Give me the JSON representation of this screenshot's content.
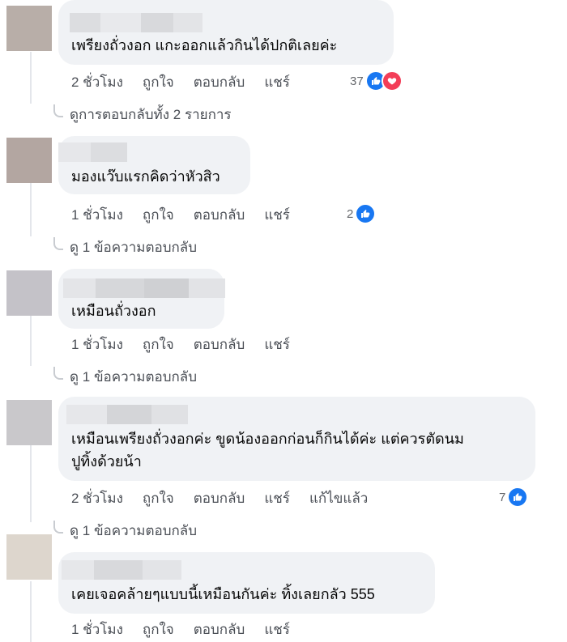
{
  "comments": [
    {
      "text_lines": [
        "เพรียงถั่วงอก แกะออกแล้วกินได้ปกติเลยค่ะ"
      ],
      "time": "2 ชั่วโมง",
      "like": "ถูกใจ",
      "reply": "ตอบกลับ",
      "share": "แชร์",
      "reaction_count": "37",
      "reaction_icons": [
        "like-icon",
        "love-icon"
      ],
      "view_replies": "ดูการตอบกลับทั้ง 2 รายการ"
    },
    {
      "text_lines": [
        "มองแว๊บแรกคิดว่าหัวสิว"
      ],
      "time": "1 ชั่วโมง",
      "like": "ถูกใจ",
      "reply": "ตอบกลับ",
      "share": "แชร์",
      "reaction_count": "2",
      "reaction_icons": [
        "like-icon"
      ],
      "view_replies": "ดู 1 ข้อความตอบกลับ"
    },
    {
      "text_lines": [
        "เหมือนถั่วงอก"
      ],
      "time": "1 ชั่วโมง",
      "like": "ถูกใจ",
      "reply": "ตอบกลับ",
      "share": "แชร์",
      "view_replies": "ดู 1 ข้อความตอบกลับ"
    },
    {
      "text_lines": [
        "เหมือนเพรียงถั่วงอกค่ะ ขูดน้องออกก่อนก็กินได้ค่ะ แต่ควรตัดนม",
        "ปูทิ้งด้วยน้า"
      ],
      "time": "2 ชั่วโมง",
      "like": "ถูกใจ",
      "reply": "ตอบกลับ",
      "share": "แชร์",
      "edited": "แก้ไขแล้ว",
      "reaction_count": "7",
      "reaction_icons": [
        "like-icon"
      ],
      "view_replies": "ดู 1 ข้อความตอบกลับ"
    },
    {
      "text_lines": [
        "เคยเจอคล้ายๆแบบนี้เหมือนกันค่ะ ทิ้งเลยกลัว 555"
      ],
      "time": "1 ชั่วโมง",
      "like": "ถูกใจ",
      "reply": "ตอบกลับ",
      "share": "แชร์"
    }
  ],
  "colors": {
    "bubble": "#f0f2f5",
    "action_text": "#4b4f56",
    "like_blue": "#1877f2",
    "love_red": "#f33e58"
  }
}
